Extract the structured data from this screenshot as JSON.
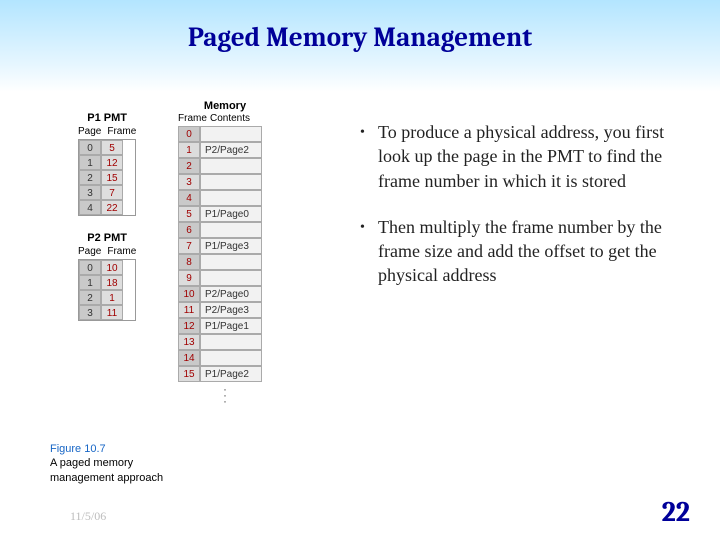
{
  "title": "Paged Memory Management",
  "bullets": [
    "To produce a physical address, you first look up the page in the PMT to find the frame number in which it is stored",
    "Then multiply the frame number by the frame size and add the offset to get the physical address"
  ],
  "caption": {
    "fig": "Figure 10.7",
    "text": "A paged memory management approach"
  },
  "footer": {
    "date": "11/5/06",
    "page": "22"
  },
  "pmt_headers": {
    "page": "Page",
    "frame": "Frame"
  },
  "memory_headers": {
    "title": "Memory",
    "frame": "Frame",
    "contents": "Contents"
  },
  "p1": {
    "title": "P1 PMT",
    "rows": [
      {
        "page": "0",
        "frame": "5"
      },
      {
        "page": "1",
        "frame": "12"
      },
      {
        "page": "2",
        "frame": "15"
      },
      {
        "page": "3",
        "frame": "7"
      },
      {
        "page": "4",
        "frame": "22"
      }
    ]
  },
  "p2": {
    "title": "P2 PMT",
    "rows": [
      {
        "page": "0",
        "frame": "10"
      },
      {
        "page": "1",
        "frame": "18"
      },
      {
        "page": "2",
        "frame": "1"
      },
      {
        "page": "3",
        "frame": "11"
      }
    ]
  },
  "memory": [
    {
      "idx": "0",
      "val": ""
    },
    {
      "idx": "1",
      "val": "P2/Page2"
    },
    {
      "idx": "2",
      "val": ""
    },
    {
      "idx": "3",
      "val": ""
    },
    {
      "idx": "4",
      "val": ""
    },
    {
      "idx": "5",
      "val": "P1/Page0"
    },
    {
      "idx": "6",
      "val": ""
    },
    {
      "idx": "7",
      "val": "P1/Page3"
    },
    {
      "idx": "8",
      "val": ""
    },
    {
      "idx": "9",
      "val": ""
    },
    {
      "idx": "10",
      "val": "P2/Page0"
    },
    {
      "idx": "11",
      "val": "P2/Page3"
    },
    {
      "idx": "12",
      "val": "P1/Page1"
    },
    {
      "idx": "13",
      "val": ""
    },
    {
      "idx": "14",
      "val": ""
    },
    {
      "idx": "15",
      "val": "P1/Page2"
    }
  ]
}
